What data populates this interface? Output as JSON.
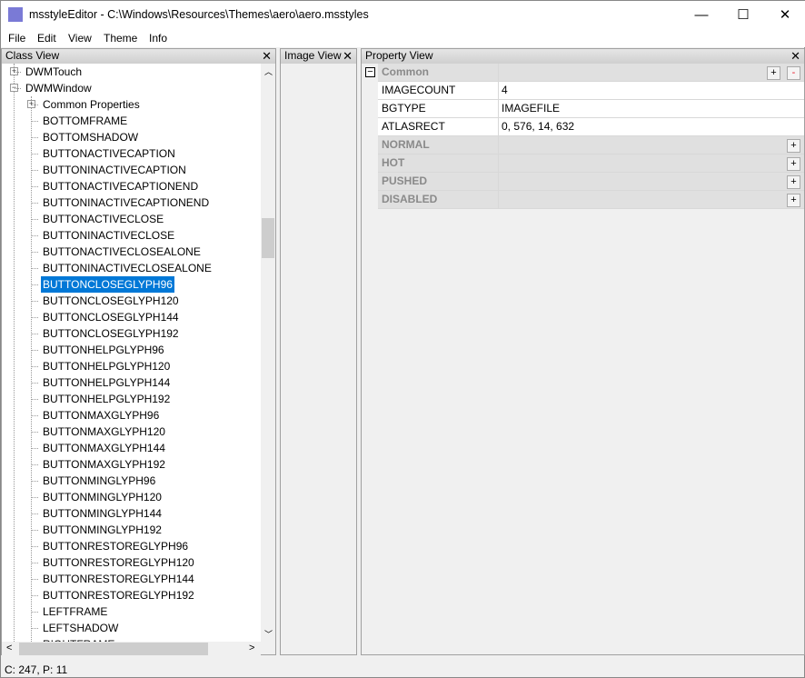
{
  "window": {
    "title": "msstyleEditor - C:\\Windows\\Resources\\Themes\\aero\\aero.msstyles",
    "minimize": "—",
    "maximize": "☐",
    "close": "✕"
  },
  "menu": [
    "File",
    "Edit",
    "View",
    "Theme",
    "Info"
  ],
  "class_view": {
    "title": "Class View",
    "close": "✕",
    "roots": [
      {
        "label": "DWMTouch",
        "expander": "+"
      },
      {
        "label": "DWMWindow",
        "expander": "−"
      }
    ],
    "common": {
      "label": "Common Properties",
      "expander": "+"
    },
    "items": [
      "BOTTOMFRAME",
      "BOTTOMSHADOW",
      "BUTTONACTIVECAPTION",
      "BUTTONINACTIVECAPTION",
      "BUTTONACTIVECAPTIONEND",
      "BUTTONINACTIVECAPTIONEND",
      "BUTTONACTIVECLOSE",
      "BUTTONINACTIVECLOSE",
      "BUTTONACTIVECLOSEALONE",
      "BUTTONINACTIVECLOSEALONE",
      "BUTTONCLOSEGLYPH96",
      "BUTTONCLOSEGLYPH120",
      "BUTTONCLOSEGLYPH144",
      "BUTTONCLOSEGLYPH192",
      "BUTTONHELPGLYPH96",
      "BUTTONHELPGLYPH120",
      "BUTTONHELPGLYPH144",
      "BUTTONHELPGLYPH192",
      "BUTTONMAXGLYPH96",
      "BUTTONMAXGLYPH120",
      "BUTTONMAXGLYPH144",
      "BUTTONMAXGLYPH192",
      "BUTTONMINGLYPH96",
      "BUTTONMINGLYPH120",
      "BUTTONMINGLYPH144",
      "BUTTONMINGLYPH192",
      "BUTTONRESTOREGLYPH96",
      "BUTTONRESTOREGLYPH120",
      "BUTTONRESTOREGLYPH144",
      "BUTTONRESTOREGLYPH192",
      "LEFTFRAME",
      "LEFTSHADOW",
      "RIGHTFRAME"
    ],
    "selected": "BUTTONCLOSEGLYPH96"
  },
  "image_view": {
    "title": "Image View",
    "close": "✕"
  },
  "property_view": {
    "title": "Property View",
    "close": "✕",
    "common": {
      "label": "Common",
      "collapse": "−",
      "add": "+",
      "remove": "-"
    },
    "properties": [
      {
        "name": "IMAGECOUNT",
        "value": "4"
      },
      {
        "name": "BGTYPE",
        "value": "IMAGEFILE"
      },
      {
        "name": "ATLASRECT",
        "value": "0, 576, 14, 632"
      }
    ],
    "states": [
      {
        "label": "NORMAL",
        "add": "+"
      },
      {
        "label": "HOT",
        "add": "+"
      },
      {
        "label": "PUSHED",
        "add": "+"
      },
      {
        "label": "DISABLED",
        "add": "+"
      }
    ]
  },
  "status": "C: 247, P: 11",
  "colors": {
    "selection": "#0078d7",
    "remove_button": "#e81123"
  }
}
